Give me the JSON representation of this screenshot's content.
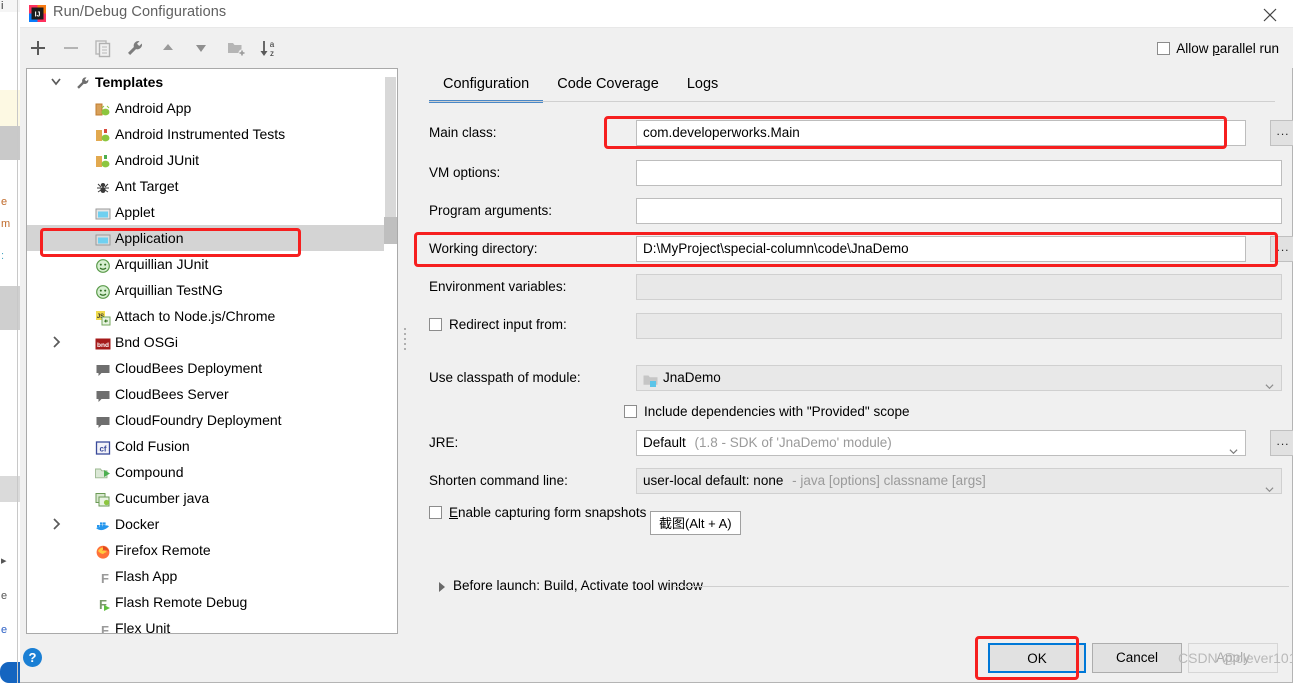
{
  "window": {
    "title": "Run/Debug Configurations",
    "app_icon": "intellij-idea-icon",
    "close_label": "✕"
  },
  "toolbar": {
    "icons": [
      {
        "name": "add-icon",
        "label": "+"
      },
      {
        "name": "remove-icon",
        "label": "−"
      },
      {
        "name": "copy-icon",
        "label": "copy"
      },
      {
        "name": "edit-templates-icon",
        "label": "wrench"
      },
      {
        "name": "move-up-icon",
        "label": "up"
      },
      {
        "name": "move-down-icon",
        "label": "down"
      },
      {
        "name": "new-folder-icon",
        "label": "folder"
      },
      {
        "name": "sort-alphabetically-icon",
        "label": "sort"
      }
    ]
  },
  "parallel_run": {
    "label_pre": "Allow ",
    "label_mnemonic": "p",
    "label_post": "arallel run",
    "checked": false
  },
  "tree": {
    "items": [
      {
        "label": "Templates",
        "level": 0,
        "icon": "wrench-icon",
        "arrow": "down",
        "selected": false,
        "bold": true
      },
      {
        "label": "Android App",
        "level": 1,
        "icon": "android-app-icon",
        "arrow": "",
        "selected": false
      },
      {
        "label": "Android Instrumented Tests",
        "level": 1,
        "icon": "android-test-icon",
        "arrow": "",
        "selected": false
      },
      {
        "label": "Android JUnit",
        "level": 1,
        "icon": "android-junit-icon",
        "arrow": "",
        "selected": false
      },
      {
        "label": "Ant Target",
        "level": 1,
        "icon": "ant-icon",
        "arrow": "",
        "selected": false
      },
      {
        "label": "Applet",
        "level": 1,
        "icon": "applet-icon",
        "arrow": "",
        "selected": false
      },
      {
        "label": "Application",
        "level": 1,
        "icon": "application-icon",
        "arrow": "",
        "selected": true
      },
      {
        "label": "Arquillian JUnit",
        "level": 1,
        "icon": "arquillian-icon",
        "arrow": "",
        "selected": false
      },
      {
        "label": "Arquillian TestNG",
        "level": 1,
        "icon": "arquillian-icon",
        "arrow": "",
        "selected": false
      },
      {
        "label": "Attach to Node.js/Chrome",
        "level": 1,
        "icon": "nodejs-attach-icon",
        "arrow": "",
        "selected": false
      },
      {
        "label": "Bnd OSGi",
        "level": 1,
        "icon": "bnd-icon",
        "arrow": "right",
        "selected": false
      },
      {
        "label": "CloudBees Deployment",
        "level": 1,
        "icon": "cloudbees-icon",
        "arrow": "",
        "selected": false
      },
      {
        "label": "CloudBees Server",
        "level": 1,
        "icon": "cloudbees-icon",
        "arrow": "",
        "selected": false
      },
      {
        "label": "CloudFoundry Deployment",
        "level": 1,
        "icon": "cloudfoundry-icon",
        "arrow": "",
        "selected": false
      },
      {
        "label": "Cold Fusion",
        "level": 1,
        "icon": "coldfusion-icon",
        "arrow": "",
        "selected": false
      },
      {
        "label": "Compound",
        "level": 1,
        "icon": "compound-icon",
        "arrow": "",
        "selected": false
      },
      {
        "label": "Cucumber java",
        "level": 1,
        "icon": "cucumber-icon",
        "arrow": "",
        "selected": false
      },
      {
        "label": "Docker",
        "level": 1,
        "icon": "docker-icon",
        "arrow": "right",
        "selected": false
      },
      {
        "label": "Firefox Remote",
        "level": 1,
        "icon": "firefox-icon",
        "arrow": "",
        "selected": false
      },
      {
        "label": "Flash App",
        "level": 1,
        "icon": "flash-icon",
        "arrow": "",
        "selected": false
      },
      {
        "label": "Flash Remote Debug",
        "level": 1,
        "icon": "flash-debug-icon",
        "arrow": "",
        "selected": false
      },
      {
        "label": "Flex Unit",
        "level": 1,
        "icon": "flash-icon",
        "arrow": "",
        "selected": false
      }
    ]
  },
  "tabs": [
    {
      "label": "Configuration",
      "active": true
    },
    {
      "label": "Code Coverage",
      "active": false
    },
    {
      "label": "Logs",
      "active": false
    }
  ],
  "fields": {
    "main_class": {
      "label": "Main class:",
      "value": "com.developerworks.Main",
      "browse": "...",
      "highlighted": true
    },
    "vm_options": {
      "label": "VM options:",
      "value": "",
      "expand_icon": "expand-icon"
    },
    "program_arguments": {
      "label": "Program arguments:",
      "value": "",
      "plus_icon": "insert-macro-icon",
      "expand_icon": "expand-icon"
    },
    "working_directory": {
      "label": "Working directory:",
      "value": "D:\\MyProject\\special-column\\code\\JnaDemo",
      "browse": "...",
      "highlighted": true
    },
    "environment_variables": {
      "label": "Environment variables:",
      "value": "",
      "folder_icon": "folder-icon"
    },
    "redirect_input": {
      "label": "Redirect input from:",
      "checked": false,
      "value": "",
      "folder_icon": "folder-icon"
    },
    "classpath_module": {
      "label": "Use classpath of module:",
      "value": "JnaDemo",
      "icon": "module-icon"
    },
    "include_provided": {
      "label": "Include dependencies with \"Provided\" scope",
      "checked": false
    },
    "jre": {
      "label": "JRE:",
      "value": "Default",
      "value_dim": "(1.8 - SDK of 'JnaDemo' module)",
      "browse": "..."
    },
    "shorten_command_line": {
      "label": "Shorten command line:",
      "value": "user-local default: none",
      "value_dim": "- java [options] classname [args]"
    },
    "enable_capturing": {
      "label_pre": "",
      "label_mnemonic": "E",
      "label_post": "nable capturing form snapshots",
      "checked": false
    }
  },
  "tooltip": {
    "text": "截图(Alt + A)"
  },
  "before_launch": {
    "label": "Before launch: Build, Activate tool window",
    "arrow": "right"
  },
  "buttons": {
    "help": "?",
    "ok": "OK",
    "cancel": "Cancel",
    "apply": "Apply"
  },
  "watermark": {
    "text": "CSDN @clever101"
  },
  "colors": {
    "accent": "#4a88c7",
    "annotation": "#f61f1f",
    "focus": "#0078d7",
    "selection": "#d4d4d4",
    "dialog_bg": "#f0f0f0"
  }
}
